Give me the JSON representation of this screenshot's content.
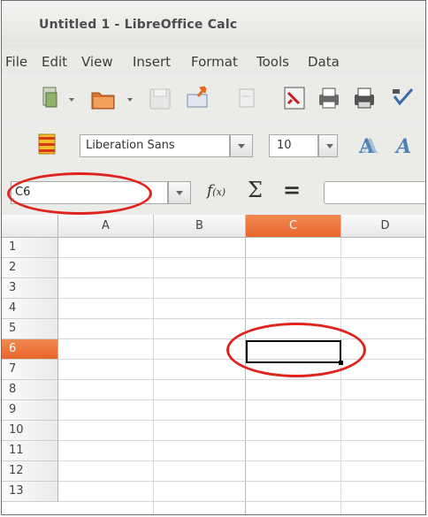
{
  "window": {
    "title": "Untitled 1 - LibreOffice Calc"
  },
  "menu": [
    "File",
    "Edit",
    "View",
    "Insert",
    "Format",
    "Tools",
    "Data"
  ],
  "toolbar": {
    "font_name": "Liberation Sans",
    "font_size": "10"
  },
  "formula_bar": {
    "name_box": "C6",
    "fx_label": "f",
    "fx_sub": "(x)",
    "sigma_label": "Σ",
    "equals_label": "="
  },
  "sheet": {
    "columns": [
      "A",
      "B",
      "C",
      "D"
    ],
    "selected_column": "C",
    "rows": [
      "1",
      "2",
      "3",
      "4",
      "5",
      "6",
      "7",
      "8",
      "9",
      "10",
      "11",
      "12",
      "13"
    ],
    "selected_row": "6",
    "active_cell": "C6"
  },
  "colors": {
    "selection_accent": "#e8652c",
    "annotation_circle": "#e0241d"
  }
}
